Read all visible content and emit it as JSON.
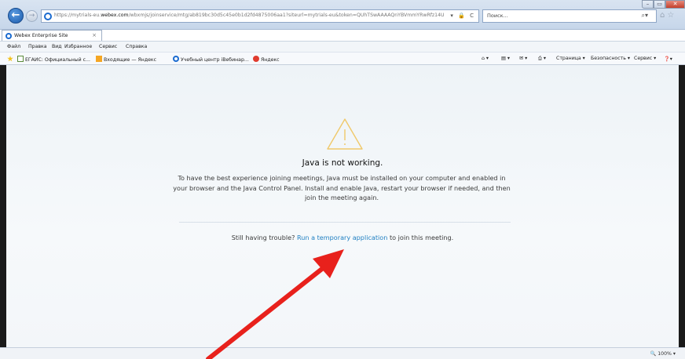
{
  "browser": {
    "address_url_prefix": "https://mytrials-eu.",
    "address_url_domain": "webex.com",
    "address_url_rest": "/wbxmjs/joinservice/mtg/ab819bc30d5c45e0b1d2fd4875006aa1?siteurl=mytrials-eu&token=QUhTSwAAAAQnYBVmmYRwRfz14U",
    "address_controls": "▾ 🔒 C",
    "search_placeholder": "Поиск...",
    "tab_title": "Webex Enterprise Site",
    "tab_close": "×"
  },
  "menu": [
    "Файл",
    "Правка",
    "Вид",
    "Избранное",
    "Сервис",
    "Справка"
  ],
  "favorites": [
    {
      "label": "ЕГАИС: Официальный с...",
      "icon": "page-icon"
    },
    {
      "label": "Входящие — Яндекс",
      "icon": "mail-icon"
    },
    {
      "label": "Учебный центр iВебинар...",
      "icon": "circle-icon"
    },
    {
      "label": "Яндекс",
      "icon": "yandex-icon"
    }
  ],
  "commandbar": {
    "page": "Страница ▾",
    "safety": "Безопасность ▾",
    "tools": "Сервис ▾"
  },
  "page": {
    "title": "Java is not working.",
    "description": "To have the best experience joining meetings, Java must be installed on your computer and enabled in your browser and the Java Control Panel. Install and enable Java, restart your browser if needed, and then join the meeting again.",
    "trouble_prefix": "Still having trouble? ",
    "trouble_link": "Run a temporary application",
    "trouble_suffix": " to join this meeting."
  },
  "statusbar": {
    "zoom": "100%"
  },
  "colors": {
    "link": "#1f7fc2",
    "warning_icon": "#f0c96a",
    "annotation_arrow": "#e8211c"
  }
}
